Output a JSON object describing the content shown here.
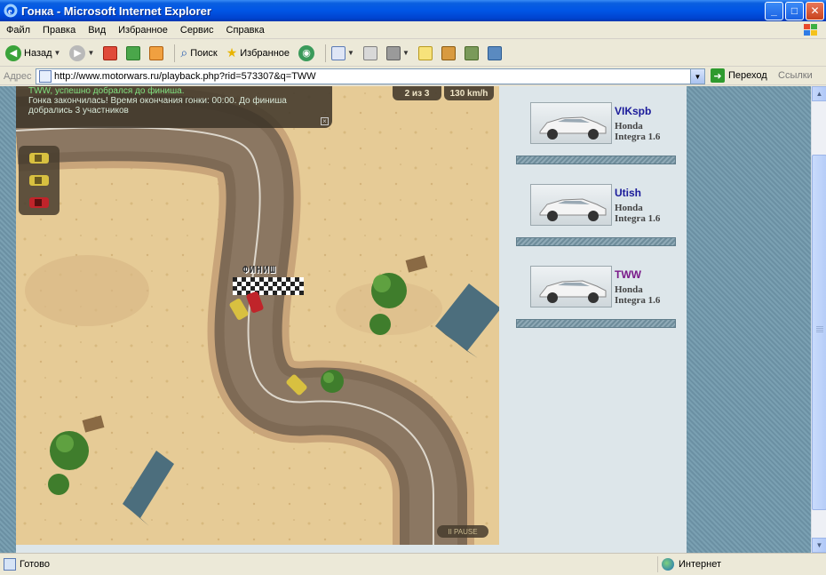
{
  "window": {
    "title": "Гонка - Microsoft Internet Explorer",
    "buttons": [
      "_",
      "□",
      "✕"
    ]
  },
  "menu": [
    "Файл",
    "Правка",
    "Вид",
    "Избранное",
    "Сервис",
    "Справка"
  ],
  "toolbar": {
    "back_label": "Назад",
    "search_label": "Поиск",
    "favorites_label": "Избранное"
  },
  "address": {
    "label": "Адрес",
    "url": "http://www.motorwars.ru/playback.php?rid=573307&q=TWW",
    "go_label": "Переход",
    "links_label": "Ссылки"
  },
  "game": {
    "messages": [
      "TWW, успешно добрался до финиша.",
      "Гонка закончилась! Время окончания гонки: 00:00. До финиша",
      "добрались 3 участников"
    ],
    "lap": "2 из 3",
    "speed": "130 km/h",
    "finish_label": "ФИНИШ",
    "pause_label": "II PAUSE"
  },
  "racers": [
    {
      "name": "VIKspb",
      "car_line1": "Honda",
      "car_line2": "Integra 1.6",
      "color": "#1a1a9a"
    },
    {
      "name": "Utish",
      "car_line1": "Honda",
      "car_line2": "Integra 1.6",
      "color": "#1a1a9a"
    },
    {
      "name": "TWW",
      "car_line1": "Honda",
      "car_line2": "Integra 1.6",
      "color": "#7a1a8a"
    }
  ],
  "status": {
    "text": "Готово",
    "zone": "Интернет"
  }
}
